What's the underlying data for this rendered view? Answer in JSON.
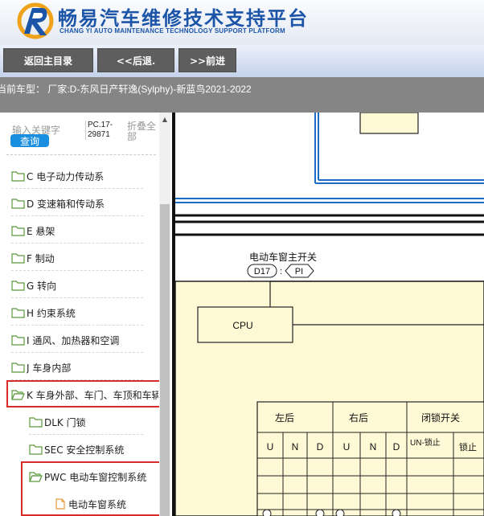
{
  "header": {
    "title_cn": "畅易汽车维修技术支持平台",
    "title_en": "CHANG YI AUTO MAINTENANCE TECHNOLOGY SUPPORT PLATFORM"
  },
  "nav": {
    "home": "返回主目录",
    "back": "<<后退.",
    "forward": ">>前进"
  },
  "vehicle": {
    "text": "当前车型：  厂家:D-东风日产轩逸(Sylphy)-新蓝鸟2021-2022"
  },
  "sidebar": {
    "search_placeholder": "输入关键字",
    "search_button": "查询",
    "code": "PC.17-29871",
    "collapse_all": "折叠全部",
    "items": [
      {
        "label": "C 电子动力传动系"
      },
      {
        "label": "D 变速箱和传动系"
      },
      {
        "label": "E 悬架"
      },
      {
        "label": "F 制动"
      },
      {
        "label": "G 转向"
      },
      {
        "label": "H 约束系统"
      },
      {
        "label": "I 通风、加热器和空调"
      },
      {
        "label": "J 车身内部"
      },
      {
        "label": "K 车身外部、车门、车顶和车辆安全"
      },
      {
        "label": "DLK 门锁"
      },
      {
        "label": "SEC 安全控制系统"
      },
      {
        "label": "PWC 电动车窗控制系统"
      },
      {
        "label": "电动车窗系统"
      }
    ]
  },
  "diagram": {
    "title": "电动车窗主开关",
    "connector": "D17",
    "harness": "PI",
    "cpu_label": "CPU",
    "group_rear_left": "左后",
    "group_rear_right": "右后",
    "group_lock": "闭锁开关",
    "col_u1": "U",
    "col_n1": "N",
    "col_d1": "D",
    "col_u2": "U",
    "col_n2": "N",
    "col_d2": "D",
    "col_unlock": "UN-锁止",
    "col_lock": "锁止"
  },
  "colors": {
    "accent_blue": "#1a6cc4",
    "highlight_red": "#d92a2a",
    "diagram_yellow": "#fff9d6"
  }
}
